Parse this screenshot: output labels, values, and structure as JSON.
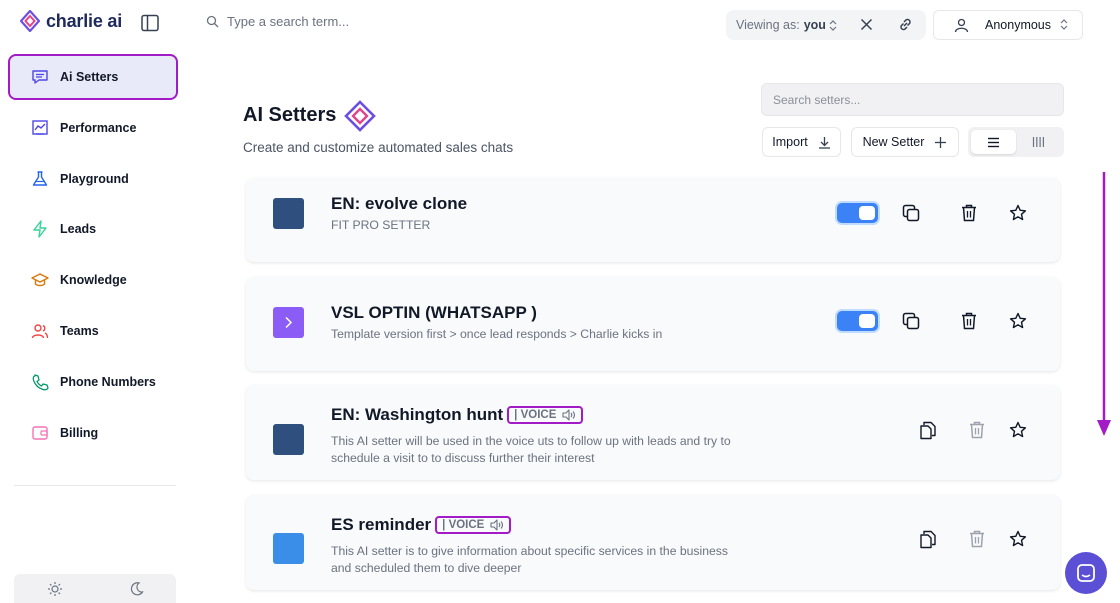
{
  "app": {
    "name": "charlie ai"
  },
  "sidebar": {
    "items": [
      {
        "label": "Ai Setters",
        "icon": "chat-icon",
        "active": true
      },
      {
        "label": "Performance",
        "icon": "chart-icon"
      },
      {
        "label": "Playground",
        "icon": "flask-icon"
      },
      {
        "label": "Leads",
        "icon": "bolt-icon"
      },
      {
        "label": "Knowledge",
        "icon": "graduation-cap-icon"
      },
      {
        "label": "Teams",
        "icon": "users-icon"
      },
      {
        "label": "Phone Numbers",
        "icon": "phone-icon"
      },
      {
        "label": "Billing",
        "icon": "wallet-icon"
      }
    ]
  },
  "topbar": {
    "search_placeholder": "Type a search term...",
    "viewing_label": "Viewing as:",
    "viewing_value": "you",
    "user_name": "Anonymous"
  },
  "header": {
    "title": "AI Setters",
    "subtitle": "Create and customize automated sales chats",
    "search_placeholder": "Search setters...",
    "import_label": "Import",
    "new_setter_label": "New Setter"
  },
  "setters": [
    {
      "name": "EN: evolve clone",
      "description": "FIT PRO SETTER",
      "color": "#2f4f7f",
      "enabled": true,
      "voice": false
    },
    {
      "name": "VSL OPTIN (WHATSAPP )",
      "description": "Template version first > once lead responds > Charlie kicks in",
      "color": "#8b5cf6",
      "enabled": true,
      "voice": false
    },
    {
      "name": "EN: Washington hunt",
      "description": "This AI setter will be used in the voice uts to follow up with leads and try to schedule a visit to to discuss further their interest",
      "color": "#2f4f7f",
      "voice": true,
      "tag": "| VOICE"
    },
    {
      "name": "ES reminder",
      "description": "This AI setter is to give information about specific services in the business and scheduled them to dive deeper",
      "color": "#3b8ee8",
      "voice": true,
      "tag": "| VOICE"
    }
  ],
  "colors": {
    "accent": "#a31ac7",
    "toggle_on": "#3b82f6",
    "chat": "#5b4fd6"
  }
}
